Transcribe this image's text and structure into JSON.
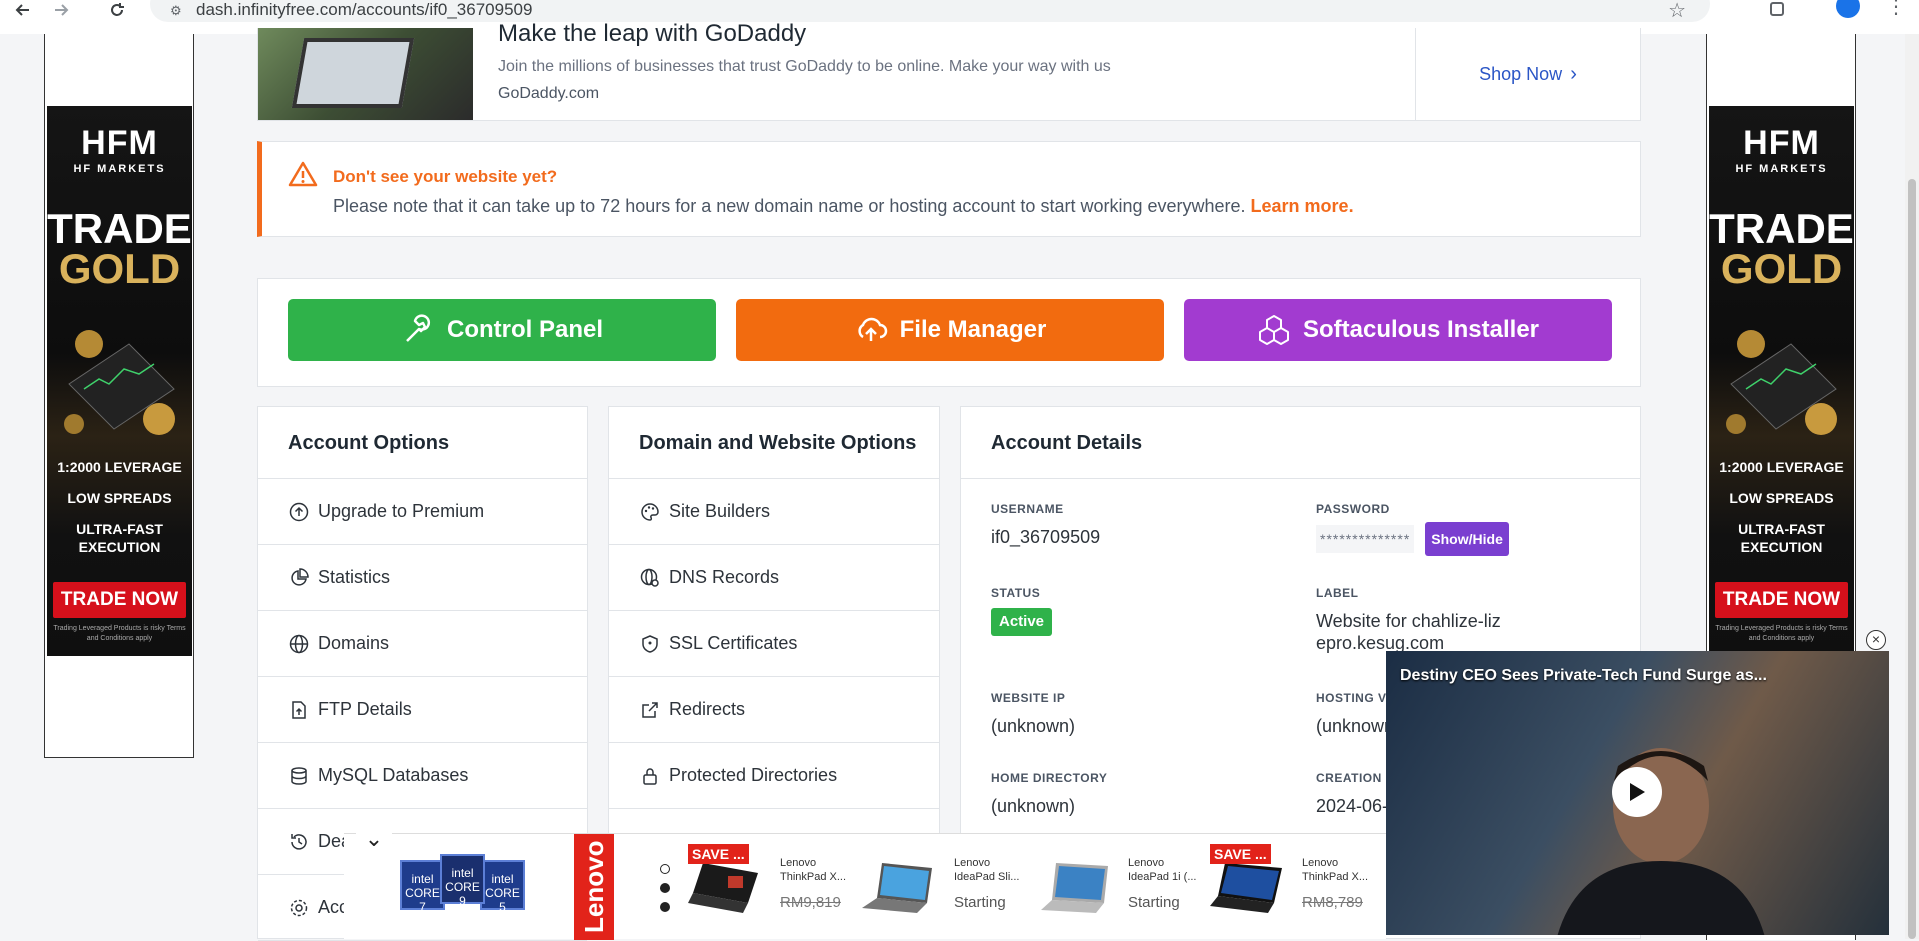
{
  "browser": {
    "url": "dash.infinityfree.com/accounts/if0_36709509"
  },
  "godaddy_ad": {
    "title": "Make the leap with GoDaddy",
    "description": "Join the millions of businesses that trust GoDaddy to be online. Make your way with us",
    "domain": "GoDaddy.com",
    "cta": "Shop Now"
  },
  "alert": {
    "title": "Don't see your website yet?",
    "text": "Please note that it can take up to 72 hours for a new domain name or hosting account to start working everywhere.",
    "link": "Learn more."
  },
  "actions": {
    "control_panel": "Control Panel",
    "file_manager": "File Manager",
    "softaculous": "Softaculous Installer"
  },
  "account_options": {
    "title": "Account Options",
    "items": [
      {
        "label": "Upgrade to Premium",
        "icon": "arrow-up-circle-icon"
      },
      {
        "label": "Statistics",
        "icon": "pie-chart-icon"
      },
      {
        "label": "Domains",
        "icon": "globe-icon"
      },
      {
        "label": "FTP Details",
        "icon": "file-upload-icon"
      },
      {
        "label": "MySQL Databases",
        "icon": "database-icon"
      },
      {
        "label": "Dea",
        "icon": "history-icon"
      },
      {
        "label": "Acc",
        "icon": "gear-icon"
      }
    ]
  },
  "domain_options": {
    "title": "Domain and Website Options",
    "items": [
      {
        "label": "Site Builders",
        "icon": "palette-icon"
      },
      {
        "label": "DNS Records",
        "icon": "dns-globe-icon"
      },
      {
        "label": "SSL Certificates",
        "icon": "shield-icon"
      },
      {
        "label": "Redirects",
        "icon": "external-link-icon"
      },
      {
        "label": "Protected Directories",
        "icon": "lock-icon"
      }
    ]
  },
  "account_details": {
    "title": "Account Details",
    "username_label": "USERNAME",
    "username": "if0_36709509",
    "password_label": "PASSWORD",
    "password_mask": "**************",
    "show_hide": "Show/Hide",
    "status_label": "STATUS",
    "status": "Active",
    "label_label": "LABEL",
    "label": "Website for chahlize-lizepro.kesug.com",
    "website_ip_label": "WEBSITE IP",
    "website_ip": "(unknown)",
    "hosting_volume_label": "HOSTING VO",
    "hosting_volume": "(unknown",
    "home_dir_label": "HOME DIRECTORY",
    "home_dir": "(unknown)",
    "creation_label": "CREATION D",
    "creation": "2024-06-"
  },
  "side_ad": {
    "brand": "HFM",
    "brand_sub": "HF MARKETS",
    "line1": "TRADE",
    "line2": "GOLD",
    "leverage": "1:2000 LEVERAGE",
    "spreads": "LOW SPREADS",
    "execution": "ULTRA-FAST EXECUTION",
    "cta": "TRADE NOW",
    "fine": "Trading Leveraged Products is risky Terms and Conditions apply"
  },
  "bottom_ad": {
    "brand": "Lenovo",
    "intel": [
      "intel CORE 7",
      "intel CORE 9",
      "intel CORE 5"
    ],
    "products": [
      {
        "save": "SAVE ...",
        "name": "Lenovo ThinkPad X...",
        "price": "RM9,819"
      },
      {
        "save": "",
        "name": "Lenovo IdeaPad Sli...",
        "price": "Starting"
      },
      {
        "save": "",
        "name": "Lenovo IdeaPad 1i (...",
        "price": "Starting"
      },
      {
        "save": "SAVE ...",
        "name": "Lenovo ThinkPad X...",
        "price": "RM8,789"
      }
    ]
  },
  "video": {
    "title": "Destiny CEO Sees Private-Tech Fund Surge as..."
  }
}
